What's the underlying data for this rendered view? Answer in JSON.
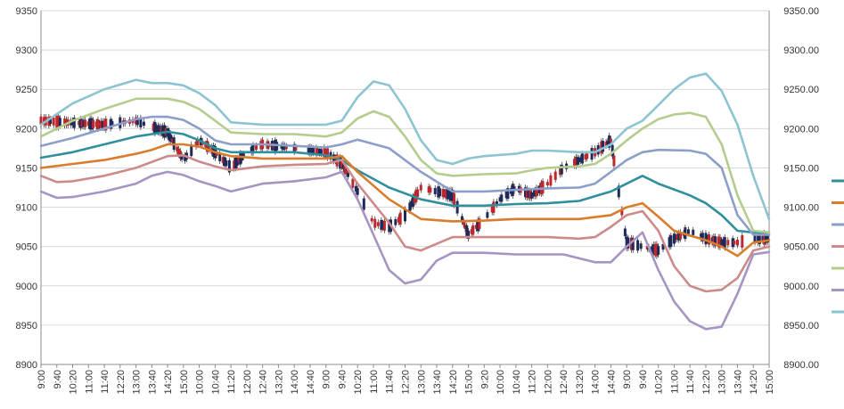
{
  "chart_data": {
    "type": "line",
    "title": "",
    "left_axis": {
      "min": 8900,
      "max": 9350,
      "step": 50,
      "ticks": [
        "8900",
        "8950",
        "9000",
        "9050",
        "9100",
        "9150",
        "9200",
        "9250",
        "9300",
        "9350"
      ]
    },
    "right_axis": {
      "min": 8900,
      "max": 9350,
      "step": 50,
      "ticks": [
        "8900.00",
        "8950.00",
        "9000.00",
        "9050.00",
        "9100.00",
        "9150.00",
        "9200.00",
        "9250.00",
        "9300.00",
        "9350.00"
      ]
    },
    "x_tick_labels": [
      "9:00",
      "9:40",
      "10:20",
      "11:00",
      "11:40",
      "12:20",
      "13:00",
      "13:40",
      "14:20",
      "15:00",
      "10:00",
      "10:40",
      "11:20",
      "12:00",
      "12:40",
      "13:20",
      "14:00",
      "14:40",
      "9:00",
      "9:40",
      "10:20",
      "11:00",
      "11:40",
      "12:20",
      "13:00",
      "13:40",
      "14:20",
      "15:00",
      "9:20",
      "10:00",
      "10:40",
      "11:20",
      "12:00",
      "12:40",
      "13:20",
      "14:00",
      "14:40",
      "9:00",
      "9:40",
      "10:20",
      "11:00",
      "11:40",
      "12:20",
      "13:00",
      "13:40",
      "14:20",
      "15:00"
    ],
    "grid": "horizontal",
    "x_range": [
      0,
      46
    ],
    "series": [
      {
        "color": "#2f8f9d",
        "role": "mid",
        "points": [
          [
            0,
            9163
          ],
          [
            2,
            9170
          ],
          [
            4,
            9180
          ],
          [
            6,
            9190
          ],
          [
            8,
            9196
          ],
          [
            9,
            9193
          ],
          [
            10,
            9185
          ],
          [
            11,
            9175
          ],
          [
            12,
            9170
          ],
          [
            14,
            9170
          ],
          [
            16,
            9170
          ],
          [
            18,
            9166
          ],
          [
            19,
            9160
          ],
          [
            20,
            9147
          ],
          [
            22,
            9125
          ],
          [
            24,
            9110
          ],
          [
            26,
            9102
          ],
          [
            28,
            9102
          ],
          [
            30,
            9104
          ],
          [
            32,
            9105
          ],
          [
            34,
            9108
          ],
          [
            36,
            9120
          ],
          [
            37,
            9130
          ],
          [
            38,
            9140
          ],
          [
            39,
            9130
          ],
          [
            41,
            9115
          ],
          [
            42,
            9105
          ],
          [
            43,
            9090
          ],
          [
            44,
            9070
          ],
          [
            45,
            9068
          ],
          [
            46,
            9068
          ]
        ]
      },
      {
        "color": "#d97c2b",
        "role": "lower-1",
        "points": [
          [
            0,
            9150
          ],
          [
            2,
            9155
          ],
          [
            4,
            9160
          ],
          [
            6,
            9168
          ],
          [
            7,
            9173
          ],
          [
            8,
            9180
          ],
          [
            9,
            9180
          ],
          [
            10,
            9177
          ],
          [
            11,
            9170
          ],
          [
            12,
            9165
          ],
          [
            14,
            9162
          ],
          [
            16,
            9162
          ],
          [
            18,
            9162
          ],
          [
            19,
            9165
          ],
          [
            20,
            9145
          ],
          [
            22,
            9110
          ],
          [
            24,
            9085
          ],
          [
            26,
            9082
          ],
          [
            28,
            9083
          ],
          [
            30,
            9085
          ],
          [
            32,
            9085
          ],
          [
            34,
            9085
          ],
          [
            36,
            9090
          ],
          [
            37,
            9100
          ],
          [
            38,
            9105
          ],
          [
            39,
            9088
          ],
          [
            40,
            9070
          ],
          [
            42,
            9058
          ],
          [
            43,
            9050
          ],
          [
            44,
            9038
          ],
          [
            45,
            9055
          ],
          [
            46,
            9058
          ]
        ]
      },
      {
        "color": "#8b9fc9",
        "role": "upper-1",
        "points": [
          [
            0,
            9178
          ],
          [
            2,
            9188
          ],
          [
            4,
            9200
          ],
          [
            6,
            9212
          ],
          [
            7,
            9215
          ],
          [
            8,
            9215
          ],
          [
            9,
            9211
          ],
          [
            10,
            9200
          ],
          [
            11,
            9185
          ],
          [
            12,
            9180
          ],
          [
            14,
            9180
          ],
          [
            16,
            9178
          ],
          [
            18,
            9176
          ],
          [
            19,
            9180
          ],
          [
            20,
            9186
          ],
          [
            22,
            9175
          ],
          [
            24,
            9145
          ],
          [
            26,
            9120
          ],
          [
            28,
            9120
          ],
          [
            30,
            9122
          ],
          [
            32,
            9124
          ],
          [
            34,
            9125
          ],
          [
            35,
            9130
          ],
          [
            36,
            9145
          ],
          [
            37,
            9160
          ],
          [
            38,
            9170
          ],
          [
            39,
            9173
          ],
          [
            41,
            9172
          ],
          [
            42,
            9168
          ],
          [
            43,
            9150
          ],
          [
            44,
            9090
          ],
          [
            45,
            9065
          ],
          [
            46,
            9065
          ]
        ]
      },
      {
        "color": "#cc8a8a",
        "role": "lower-2",
        "points": [
          [
            0,
            9140
          ],
          [
            1,
            9132
          ],
          [
            2,
            9133
          ],
          [
            4,
            9140
          ],
          [
            6,
            9150
          ],
          [
            8,
            9165
          ],
          [
            9,
            9166
          ],
          [
            10,
            9158
          ],
          [
            11,
            9152
          ],
          [
            12,
            9147
          ],
          [
            14,
            9152
          ],
          [
            16,
            9154
          ],
          [
            18,
            9155
          ],
          [
            19,
            9160
          ],
          [
            20,
            9130
          ],
          [
            22,
            9080
          ],
          [
            23,
            9050
          ],
          [
            24,
            9045
          ],
          [
            26,
            9062
          ],
          [
            28,
            9062
          ],
          [
            30,
            9062
          ],
          [
            32,
            9062
          ],
          [
            34,
            9060
          ],
          [
            35,
            9062
          ],
          [
            36,
            9075
          ],
          [
            37,
            9090
          ],
          [
            38,
            9095
          ],
          [
            39,
            9070
          ],
          [
            40,
            9025
          ],
          [
            41,
            9000
          ],
          [
            42,
            8993
          ],
          [
            43,
            8995
          ],
          [
            44,
            9010
          ],
          [
            45,
            9045
          ],
          [
            46,
            9050
          ]
        ]
      },
      {
        "color": "#b4cc8c",
        "role": "upper-2",
        "points": [
          [
            0,
            9190
          ],
          [
            2,
            9210
          ],
          [
            4,
            9225
          ],
          [
            6,
            9238
          ],
          [
            8,
            9238
          ],
          [
            9,
            9234
          ],
          [
            10,
            9225
          ],
          [
            11,
            9210
          ],
          [
            12,
            9195
          ],
          [
            14,
            9193
          ],
          [
            16,
            9193
          ],
          [
            18,
            9190
          ],
          [
            19,
            9195
          ],
          [
            20,
            9213
          ],
          [
            21,
            9222
          ],
          [
            22,
            9215
          ],
          [
            23,
            9190
          ],
          [
            24,
            9160
          ],
          [
            25,
            9143
          ],
          [
            26,
            9140
          ],
          [
            28,
            9142
          ],
          [
            30,
            9143
          ],
          [
            31,
            9147
          ],
          [
            32,
            9150
          ],
          [
            34,
            9152
          ],
          [
            35,
            9155
          ],
          [
            36,
            9168
          ],
          [
            37,
            9185
          ],
          [
            38,
            9200
          ],
          [
            39,
            9212
          ],
          [
            40,
            9218
          ],
          [
            41,
            9220
          ],
          [
            42,
            9215
          ],
          [
            43,
            9180
          ],
          [
            44,
            9115
          ],
          [
            45,
            9070
          ],
          [
            46,
            9068
          ]
        ]
      },
      {
        "color": "#a694c2",
        "role": "lower-3",
        "points": [
          [
            0,
            9120
          ],
          [
            1,
            9112
          ],
          [
            2,
            9113
          ],
          [
            4,
            9120
          ],
          [
            6,
            9130
          ],
          [
            7,
            9140
          ],
          [
            8,
            9145
          ],
          [
            9,
            9141
          ],
          [
            10,
            9133
          ],
          [
            11,
            9127
          ],
          [
            12,
            9120
          ],
          [
            13,
            9125
          ],
          [
            14,
            9130
          ],
          [
            16,
            9133
          ],
          [
            18,
            9138
          ],
          [
            19,
            9145
          ],
          [
            20,
            9110
          ],
          [
            21,
            9065
          ],
          [
            22,
            9020
          ],
          [
            23,
            9003
          ],
          [
            24,
            9008
          ],
          [
            25,
            9032
          ],
          [
            26,
            9042
          ],
          [
            28,
            9042
          ],
          [
            30,
            9040
          ],
          [
            32,
            9040
          ],
          [
            33,
            9040
          ],
          [
            34,
            9035
          ],
          [
            35,
            9030
          ],
          [
            36,
            9030
          ],
          [
            37,
            9050
          ],
          [
            38,
            9068
          ],
          [
            39,
            9020
          ],
          [
            40,
            8980
          ],
          [
            41,
            8955
          ],
          [
            42,
            8945
          ],
          [
            43,
            8948
          ],
          [
            44,
            8990
          ],
          [
            45,
            9040
          ],
          [
            46,
            9043
          ]
        ]
      },
      {
        "color": "#8cc4d2",
        "role": "upper-3",
        "points": [
          [
            0,
            9205
          ],
          [
            2,
            9232
          ],
          [
            4,
            9250
          ],
          [
            6,
            9262
          ],
          [
            7,
            9258
          ],
          [
            8,
            9258
          ],
          [
            9,
            9255
          ],
          [
            10,
            9245
          ],
          [
            11,
            9230
          ],
          [
            12,
            9208
          ],
          [
            14,
            9205
          ],
          [
            16,
            9205
          ],
          [
            18,
            9205
          ],
          [
            19,
            9210
          ],
          [
            20,
            9240
          ],
          [
            21,
            9260
          ],
          [
            22,
            9255
          ],
          [
            23,
            9225
          ],
          [
            24,
            9185
          ],
          [
            25,
            9160
          ],
          [
            26,
            9155
          ],
          [
            27,
            9162
          ],
          [
            28,
            9165
          ],
          [
            30,
            9168
          ],
          [
            31,
            9172
          ],
          [
            32,
            9172
          ],
          [
            34,
            9170
          ],
          [
            35,
            9170
          ],
          [
            36,
            9180
          ],
          [
            37,
            9200
          ],
          [
            38,
            9210
          ],
          [
            39,
            9230
          ],
          [
            40,
            9250
          ],
          [
            41,
            9265
          ],
          [
            42,
            9270
          ],
          [
            43,
            9248
          ],
          [
            44,
            9205
          ],
          [
            45,
            9140
          ],
          [
            46,
            9085
          ]
        ]
      }
    ]
  }
}
